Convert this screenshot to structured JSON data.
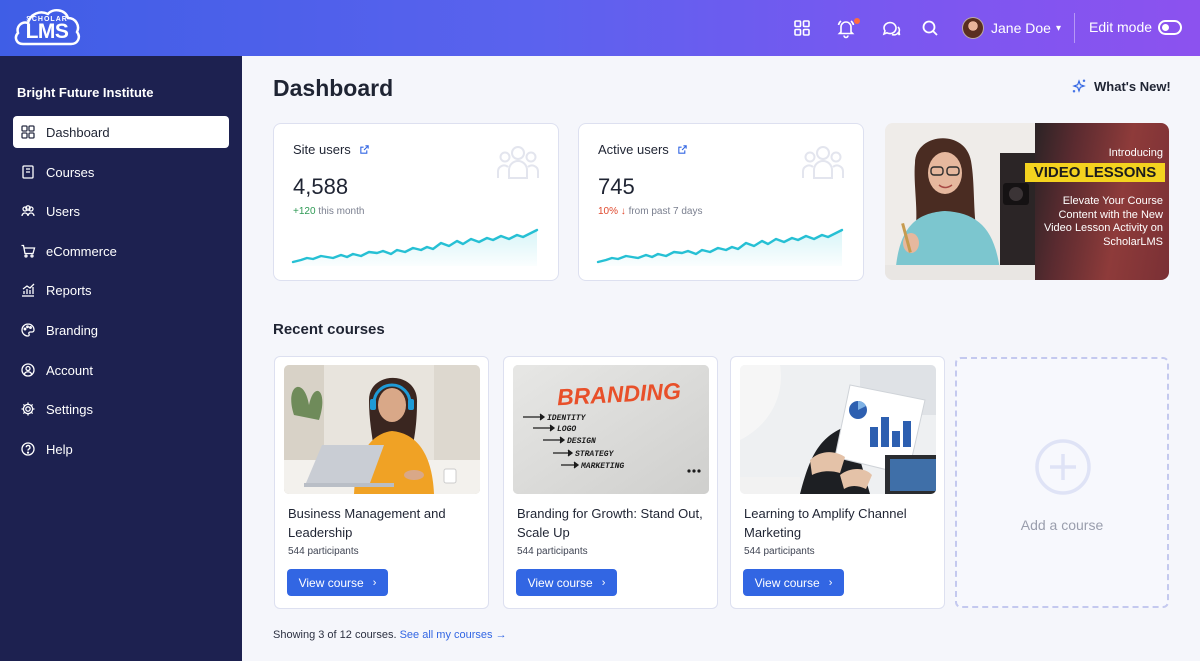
{
  "brand": {
    "logo_small": "SCHOLAR",
    "logo_big": "LMS"
  },
  "topbar": {
    "user_name": "Jane Doe",
    "edit_mode_label": "Edit mode"
  },
  "sidebar": {
    "org_name": "Bright Future Institute",
    "items": [
      {
        "label": "Dashboard",
        "icon": "grid-icon",
        "active": true
      },
      {
        "label": "Courses",
        "icon": "book-icon"
      },
      {
        "label": "Users",
        "icon": "users-icon"
      },
      {
        "label": "eCommerce",
        "icon": "cart-icon"
      },
      {
        "label": "Reports",
        "icon": "chart-icon"
      },
      {
        "label": "Branding",
        "icon": "palette-icon"
      },
      {
        "label": "Account",
        "icon": "account-icon"
      },
      {
        "label": "Settings",
        "icon": "gear-icon"
      },
      {
        "label": "Help",
        "icon": "help-icon"
      }
    ]
  },
  "main": {
    "title": "Dashboard",
    "whats_new": "What's New!",
    "stats": [
      {
        "label": "Site users",
        "value": "4,588",
        "delta": "+120",
        "delta_suffix": " this month"
      },
      {
        "label": "Active users",
        "value": "745",
        "delta": "10% ↓",
        "delta_suffix": " from past 7 days"
      }
    ],
    "promo": {
      "intro": "Introducing",
      "banner": "VIDEO LESSONS",
      "desc": "Elevate Your Course Content with the New Video Lesson Activity on ScholarLMS"
    },
    "recent_title": "Recent courses",
    "courses": [
      {
        "title": "Business Management and Leadership",
        "participants": "544 participants",
        "button": "View course"
      },
      {
        "title": "Branding for Growth: Stand Out, Scale Up",
        "participants": "544 participants",
        "button": "View course"
      },
      {
        "title": "Learning to Amplify Channel Marketing",
        "participants": "544 participants",
        "button": "View course"
      }
    ],
    "branding_image_text": {
      "heading": "BRANDING",
      "items": [
        "IDENTITY",
        "LOGO",
        "DESIGN",
        "STRATEGY",
        "MARKETING"
      ]
    },
    "add_course": "Add a course",
    "showing": "Showing 3 of 12 courses.",
    "see_all": "See all my courses →"
  },
  "colors": {
    "accent": "#3266e3",
    "sidebar_bg": "#1d2150",
    "banner_yellow": "#f4d31f"
  }
}
